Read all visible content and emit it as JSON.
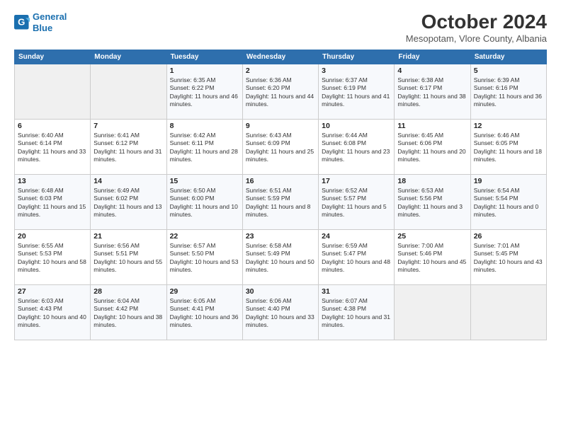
{
  "logo": {
    "line1": "General",
    "line2": "Blue"
  },
  "title": "October 2024",
  "subtitle": "Mesopotam, Vlore County, Albania",
  "weekdays": [
    "Sunday",
    "Monday",
    "Tuesday",
    "Wednesday",
    "Thursday",
    "Friday",
    "Saturday"
  ],
  "weeks": [
    [
      {
        "day": null,
        "info": null
      },
      {
        "day": null,
        "info": null
      },
      {
        "day": "1",
        "sunrise": "6:35 AM",
        "sunset": "6:22 PM",
        "daylight": "11 hours and 46 minutes."
      },
      {
        "day": "2",
        "sunrise": "6:36 AM",
        "sunset": "6:20 PM",
        "daylight": "11 hours and 44 minutes."
      },
      {
        "day": "3",
        "sunrise": "6:37 AM",
        "sunset": "6:19 PM",
        "daylight": "11 hours and 41 minutes."
      },
      {
        "day": "4",
        "sunrise": "6:38 AM",
        "sunset": "6:17 PM",
        "daylight": "11 hours and 38 minutes."
      },
      {
        "day": "5",
        "sunrise": "6:39 AM",
        "sunset": "6:16 PM",
        "daylight": "11 hours and 36 minutes."
      }
    ],
    [
      {
        "day": "6",
        "sunrise": "6:40 AM",
        "sunset": "6:14 PM",
        "daylight": "11 hours and 33 minutes."
      },
      {
        "day": "7",
        "sunrise": "6:41 AM",
        "sunset": "6:12 PM",
        "daylight": "11 hours and 31 minutes."
      },
      {
        "day": "8",
        "sunrise": "6:42 AM",
        "sunset": "6:11 PM",
        "daylight": "11 hours and 28 minutes."
      },
      {
        "day": "9",
        "sunrise": "6:43 AM",
        "sunset": "6:09 PM",
        "daylight": "11 hours and 25 minutes."
      },
      {
        "day": "10",
        "sunrise": "6:44 AM",
        "sunset": "6:08 PM",
        "daylight": "11 hours and 23 minutes."
      },
      {
        "day": "11",
        "sunrise": "6:45 AM",
        "sunset": "6:06 PM",
        "daylight": "11 hours and 20 minutes."
      },
      {
        "day": "12",
        "sunrise": "6:46 AM",
        "sunset": "6:05 PM",
        "daylight": "11 hours and 18 minutes."
      }
    ],
    [
      {
        "day": "13",
        "sunrise": "6:48 AM",
        "sunset": "6:03 PM",
        "daylight": "11 hours and 15 minutes."
      },
      {
        "day": "14",
        "sunrise": "6:49 AM",
        "sunset": "6:02 PM",
        "daylight": "11 hours and 13 minutes."
      },
      {
        "day": "15",
        "sunrise": "6:50 AM",
        "sunset": "6:00 PM",
        "daylight": "11 hours and 10 minutes."
      },
      {
        "day": "16",
        "sunrise": "6:51 AM",
        "sunset": "5:59 PM",
        "daylight": "11 hours and 8 minutes."
      },
      {
        "day": "17",
        "sunrise": "6:52 AM",
        "sunset": "5:57 PM",
        "daylight": "11 hours and 5 minutes."
      },
      {
        "day": "18",
        "sunrise": "6:53 AM",
        "sunset": "5:56 PM",
        "daylight": "11 hours and 3 minutes."
      },
      {
        "day": "19",
        "sunrise": "6:54 AM",
        "sunset": "5:54 PM",
        "daylight": "11 hours and 0 minutes."
      }
    ],
    [
      {
        "day": "20",
        "sunrise": "6:55 AM",
        "sunset": "5:53 PM",
        "daylight": "10 hours and 58 minutes."
      },
      {
        "day": "21",
        "sunrise": "6:56 AM",
        "sunset": "5:51 PM",
        "daylight": "10 hours and 55 minutes."
      },
      {
        "day": "22",
        "sunrise": "6:57 AM",
        "sunset": "5:50 PM",
        "daylight": "10 hours and 53 minutes."
      },
      {
        "day": "23",
        "sunrise": "6:58 AM",
        "sunset": "5:49 PM",
        "daylight": "10 hours and 50 minutes."
      },
      {
        "day": "24",
        "sunrise": "6:59 AM",
        "sunset": "5:47 PM",
        "daylight": "10 hours and 48 minutes."
      },
      {
        "day": "25",
        "sunrise": "7:00 AM",
        "sunset": "5:46 PM",
        "daylight": "10 hours and 45 minutes."
      },
      {
        "day": "26",
        "sunrise": "7:01 AM",
        "sunset": "5:45 PM",
        "daylight": "10 hours and 43 minutes."
      }
    ],
    [
      {
        "day": "27",
        "sunrise": "6:03 AM",
        "sunset": "4:43 PM",
        "daylight": "10 hours and 40 minutes."
      },
      {
        "day": "28",
        "sunrise": "6:04 AM",
        "sunset": "4:42 PM",
        "daylight": "10 hours and 38 minutes."
      },
      {
        "day": "29",
        "sunrise": "6:05 AM",
        "sunset": "4:41 PM",
        "daylight": "10 hours and 36 minutes."
      },
      {
        "day": "30",
        "sunrise": "6:06 AM",
        "sunset": "4:40 PM",
        "daylight": "10 hours and 33 minutes."
      },
      {
        "day": "31",
        "sunrise": "6:07 AM",
        "sunset": "4:38 PM",
        "daylight": "10 hours and 31 minutes."
      },
      {
        "day": null,
        "info": null
      },
      {
        "day": null,
        "info": null
      }
    ]
  ]
}
